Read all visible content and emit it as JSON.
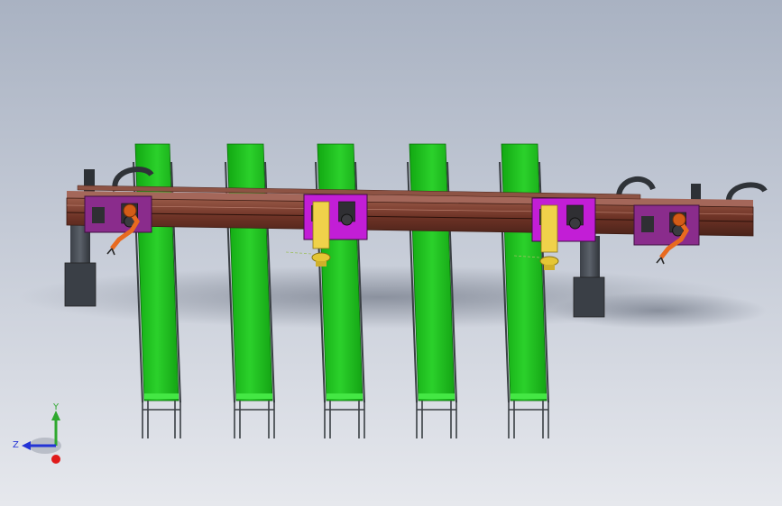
{
  "viewport": {
    "background_top": "#a9b2c2",
    "background_bottom": "#e6e8ed"
  },
  "conveyors": {
    "count": 5,
    "belt_color": "#22c41f",
    "frame_color": "#3a3f44"
  },
  "gantry": {
    "beam_color": "#7a3b2e",
    "beam_dark": "#4a2219"
  },
  "carriages": [
    {
      "type": "robot-gripper",
      "plate_color": "#8a2c8c"
    },
    {
      "type": "suction-picker",
      "plate_color": "#c21ed6"
    },
    {
      "type": "suction-picker",
      "plate_color": "#c21ed6"
    },
    {
      "type": "robot-gripper",
      "plate_color": "#8a2c8c"
    }
  ],
  "orientation_triad": {
    "y_label": "Y",
    "z_label": "Z",
    "y_color": "#2ea82e",
    "z_color": "#2333d6",
    "x_color": "#e01a1a"
  }
}
